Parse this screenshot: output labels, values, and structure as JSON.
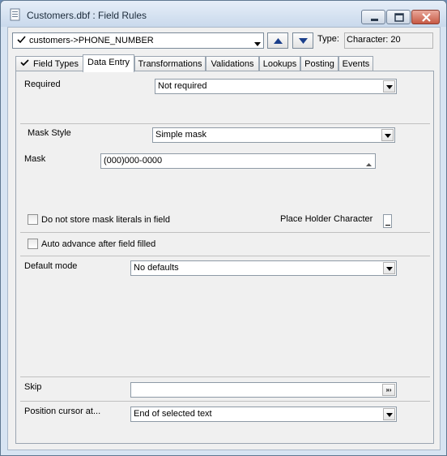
{
  "window": {
    "title": "Customers.dbf : Field Rules",
    "icon": "table-document-icon"
  },
  "toolbar": {
    "field_value": "customers->PHONE_NUMBER",
    "type_label": "Type:",
    "type_value": "Character: 20"
  },
  "tabs": [
    {
      "label": "Field Types",
      "checked": true
    },
    {
      "label": "Data Entry",
      "active": true
    },
    {
      "label": "Transformations"
    },
    {
      "label": "Validations"
    },
    {
      "label": "Lookups"
    },
    {
      "label": "Posting"
    },
    {
      "label": "Events"
    }
  ],
  "data_entry": {
    "required_label": "Required",
    "required_value": "Not required",
    "mask_style_label": "Mask Style",
    "mask_style_value": "Simple mask",
    "mask_label": "Mask",
    "mask_value": "(000)000-0000",
    "no_store_literals_label": "Do not store mask literals in field",
    "no_store_literals_checked": false,
    "placeholder_label": "Place Holder Character",
    "placeholder_value": "_",
    "auto_advance_label": "Auto advance after field filled",
    "auto_advance_checked": false,
    "default_mode_label": "Default mode",
    "default_mode_value": "No defaults",
    "skip_label": "Skip",
    "skip_value": "",
    "position_label": "Position cursor at...",
    "position_value": "End of selected text"
  }
}
